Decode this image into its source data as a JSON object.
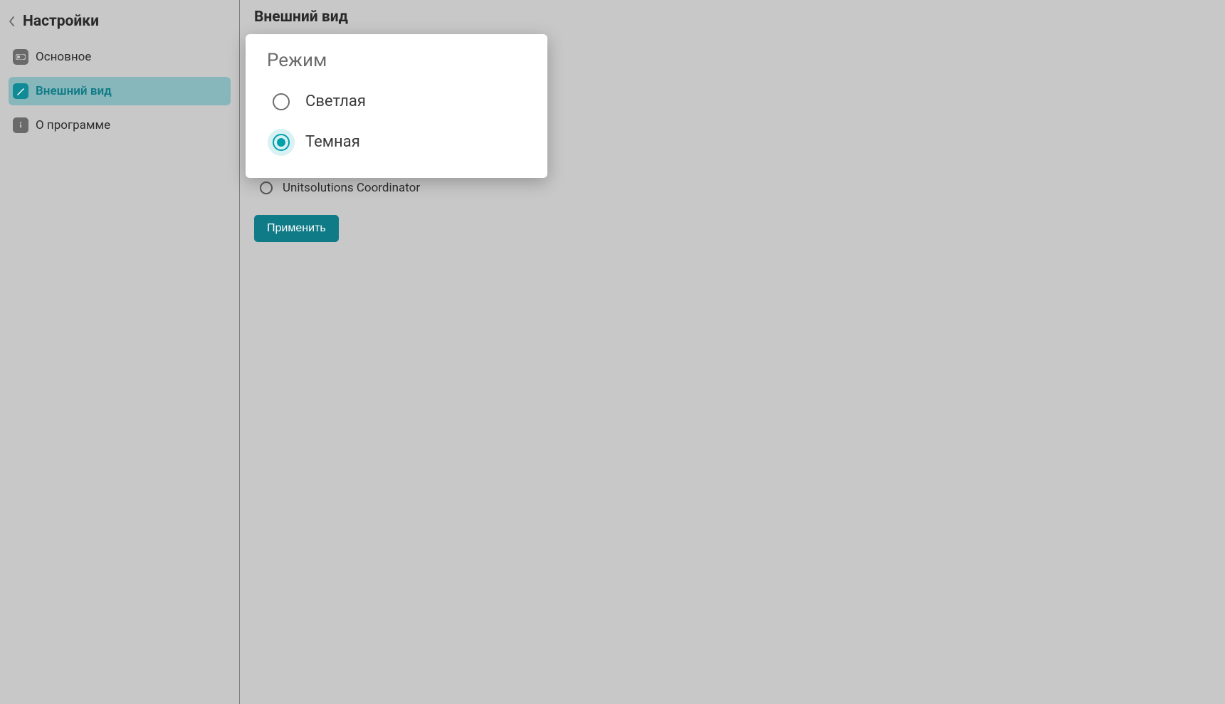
{
  "sidebar": {
    "title": "Настройки",
    "items": [
      {
        "label": "Основное",
        "active": false
      },
      {
        "label": "Внешний вид",
        "active": true
      },
      {
        "label": "О программе",
        "active": false
      }
    ]
  },
  "main": {
    "title": "Внешний вид",
    "mode_panel": {
      "title": "Режим",
      "options": [
        {
          "label": "Светлая",
          "selected": false
        },
        {
          "label": "Темная",
          "selected": true
        }
      ]
    },
    "background_option": {
      "label": "Unitsolutions Coordinator",
      "selected": false
    },
    "apply_label": "Применить"
  }
}
